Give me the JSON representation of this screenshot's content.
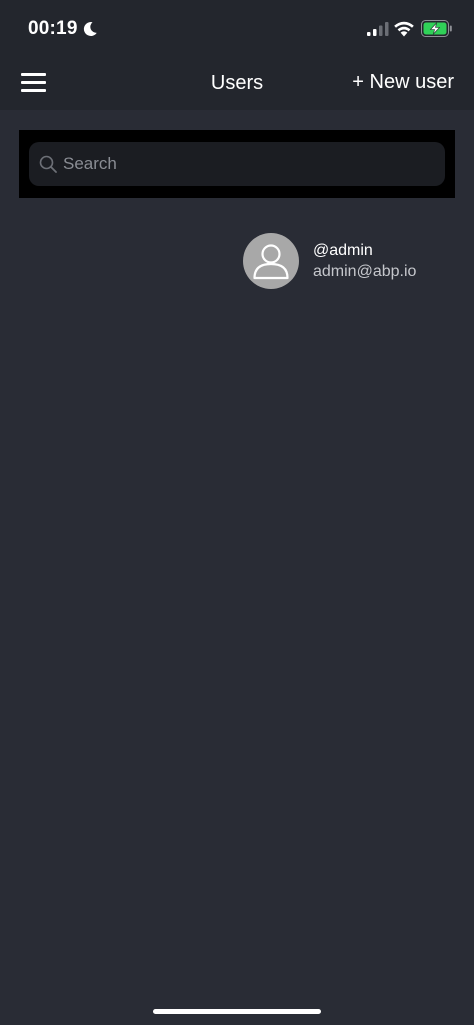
{
  "status_bar": {
    "time": "00:19",
    "moon_icon": "moon-icon",
    "signal_icon": "cellular-signal-icon",
    "wifi_icon": "wifi-icon",
    "battery_icon": "battery-charging-icon",
    "battery_color": "#30d158"
  },
  "nav": {
    "menu_icon": "hamburger-menu-icon",
    "title": "Users",
    "new_user_label": "+ New user"
  },
  "search": {
    "placeholder": "Search",
    "value": "",
    "icon": "search-icon"
  },
  "users": [
    {
      "username": "@admin",
      "email": "admin@abp.io",
      "avatar_icon": "user-placeholder-icon"
    }
  ],
  "colors": {
    "background": "#292c35",
    "header": "#23262d",
    "search_bar": "#000000",
    "search_field": "#1b1d22",
    "avatar": "#a8a8a8"
  }
}
